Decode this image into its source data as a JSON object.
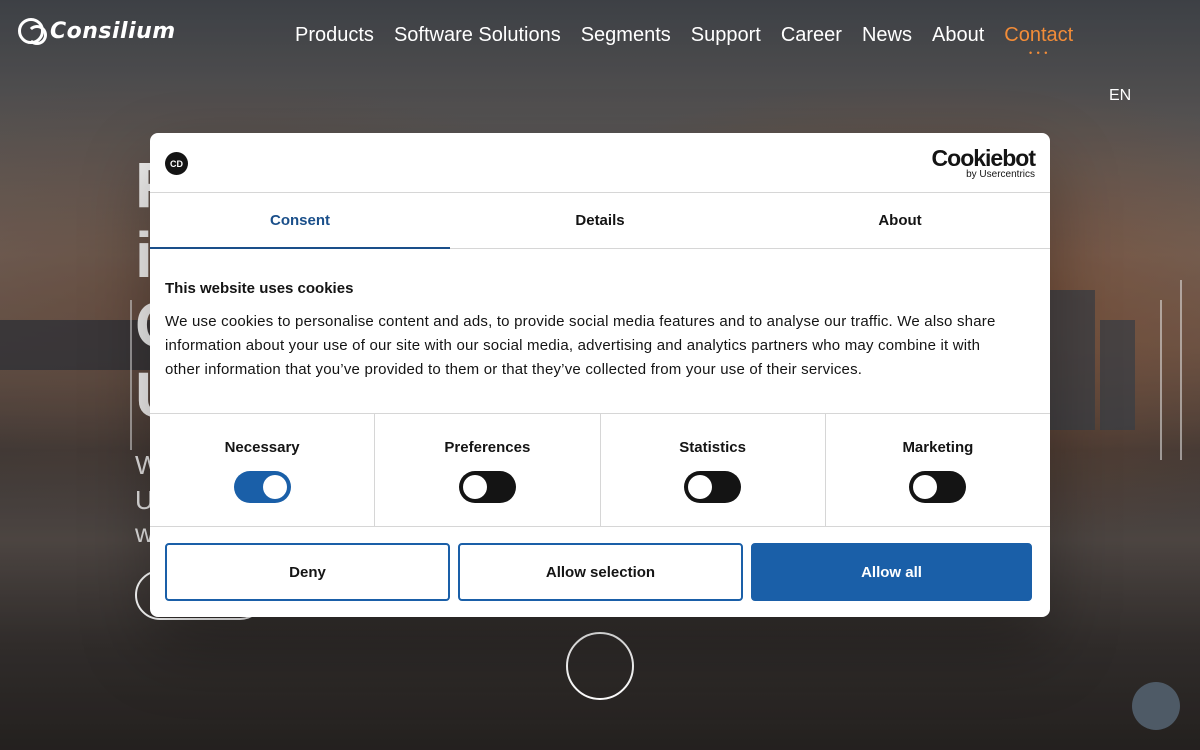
{
  "header": {
    "logo_text": "Consilium",
    "nav": [
      {
        "label": "Products",
        "active": false
      },
      {
        "label": "Software Solutions",
        "active": false
      },
      {
        "label": "Segments",
        "active": false
      },
      {
        "label": "Support",
        "active": false
      },
      {
        "label": "Career",
        "active": false
      },
      {
        "label": "News",
        "active": false
      },
      {
        "label": "About",
        "active": false
      },
      {
        "label": "Contact",
        "active": true
      }
    ],
    "language": "EN",
    "accent_color": "#f28c38"
  },
  "dialog": {
    "badge_text": "CD",
    "brand_name": "Cookiebot",
    "brand_sub": "by Usercentrics",
    "tabs": [
      {
        "label": "Consent",
        "active": true
      },
      {
        "label": "Details",
        "active": false
      },
      {
        "label": "About",
        "active": false
      }
    ],
    "title": "This website uses cookies",
    "text_lines": [
      "We use cookies to personalise content and ads, to provide social media features and to analyse our traffic. We also share",
      "information about your use of our site with our social media, advertising and analytics partners who may combine it with",
      "other information that you’ve provided to them or that they’ve collected from your use of their services."
    ],
    "categories": [
      {
        "label": "Necessary",
        "checked": true
      },
      {
        "label": "Preferences",
        "checked": false
      },
      {
        "label": "Statistics",
        "checked": false
      },
      {
        "label": "Marketing",
        "checked": false
      }
    ],
    "buttons": {
      "deny": "Deny",
      "allow_selection": "Allow selection",
      "allow_all": "Allow all"
    },
    "primary_color": "#1a5fa8"
  }
}
